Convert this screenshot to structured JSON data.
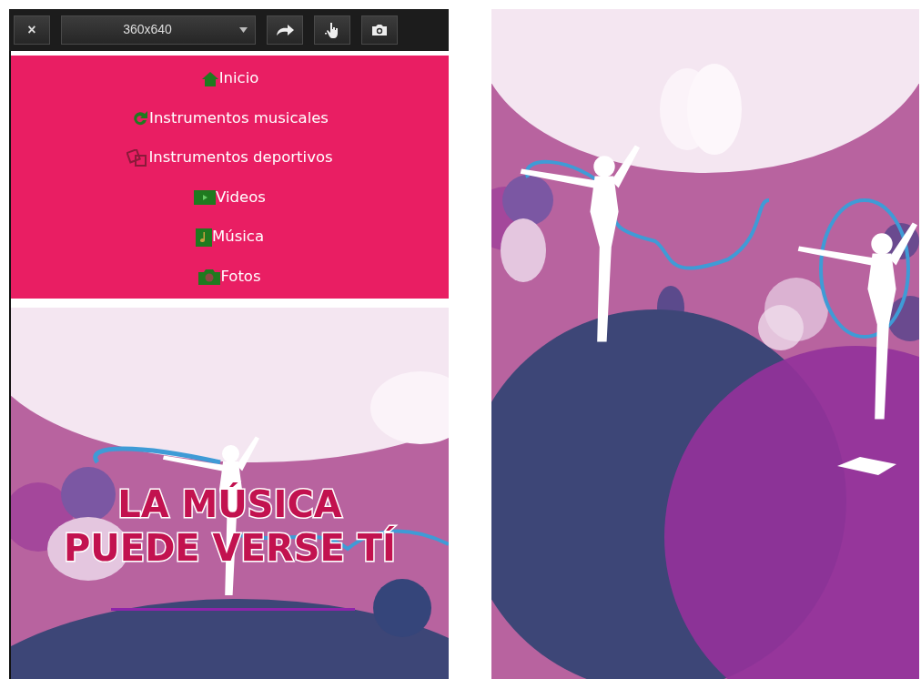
{
  "toolbar": {
    "close_label": "×",
    "resolution": "360x640"
  },
  "menu": [
    {
      "label": "Inicio"
    },
    {
      "label": "Instrumentos musicales"
    },
    {
      "label": "Instrumentos deportivos"
    },
    {
      "label": "Videos"
    },
    {
      "label": "Música"
    },
    {
      "label": "Fotos"
    }
  ],
  "banner": {
    "heading_lines": [
      "LA MÚSICA",
      "PUEDE VERSE TÍ"
    ]
  }
}
